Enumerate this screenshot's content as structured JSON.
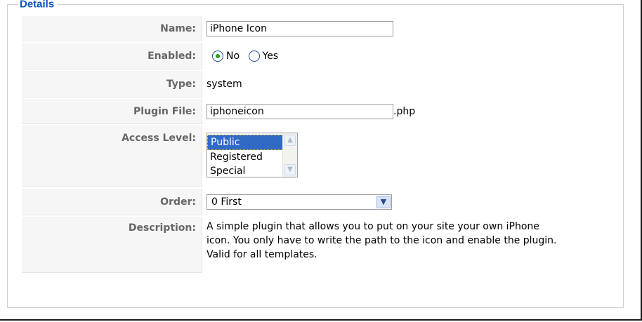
{
  "legend": "Details",
  "fields": {
    "name": {
      "label": "Name:",
      "value": "iPhone Icon"
    },
    "enabled": {
      "label": "Enabled:",
      "options": [
        "No",
        "Yes"
      ],
      "selected": "No"
    },
    "type": {
      "label": "Type:",
      "value": "system"
    },
    "plugin_file": {
      "label": "Plugin File:",
      "value": "iphoneicon",
      "suffix": ".php"
    },
    "access_level": {
      "label": "Access Level:",
      "options": [
        "Public",
        "Registered",
        "Special"
      ],
      "selected": "Public"
    },
    "order": {
      "label": "Order:",
      "value": "0 First"
    },
    "description": {
      "label": "Description:",
      "lines": [
        "A simple plugin that allows you to put on your site your own iPhone",
        "icon. You only have to write the path to the icon and enable the plugin.",
        "Valid for all templates."
      ]
    }
  },
  "colors": {
    "legend": "#0b55c4",
    "selection": "#316ac5",
    "radio_dot": "#21a121"
  },
  "icons": {
    "scroll_up": "chevron-up-icon",
    "scroll_down": "chevron-down-icon",
    "dropdown": "chevron-down-icon"
  }
}
